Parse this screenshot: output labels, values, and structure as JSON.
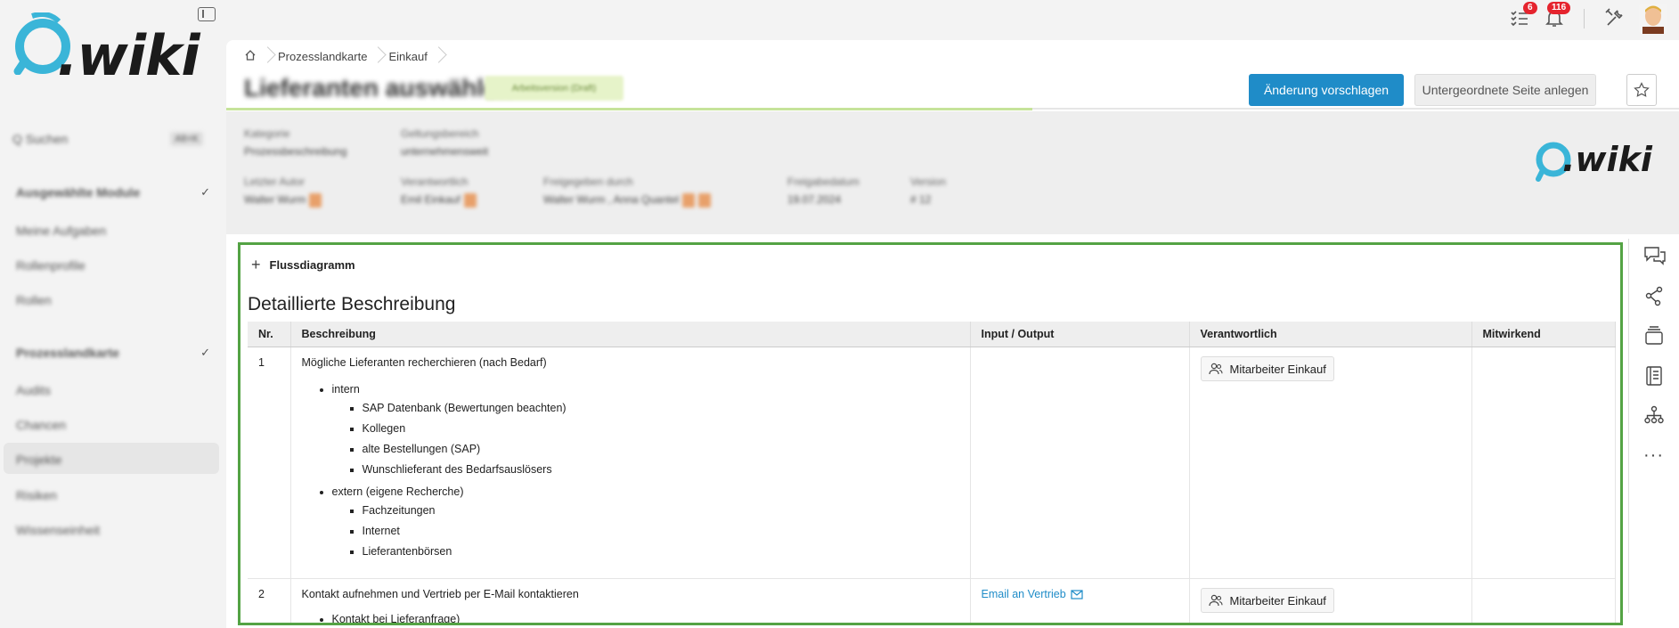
{
  "app": {
    "logo_text": ".wiki"
  },
  "sidebar": {
    "search_label": "Q Suchen",
    "search_shortcut": "Alt+K",
    "items": [
      {
        "label": "Ausgewählte Module",
        "top": 0
      },
      {
        "label": "Meine Aufgaben",
        "top": 0
      },
      {
        "label": "Rollenprofile",
        "top": 0
      },
      {
        "label": "Rollen",
        "top": 0
      },
      {
        "label": "Prozesslandkarte",
        "top": 0
      },
      {
        "label": "Audits",
        "top": 0
      },
      {
        "label": "Chancen",
        "top": 0
      },
      {
        "label": "Projekte",
        "top": 0
      },
      {
        "label": "Risiken",
        "top": 0
      },
      {
        "label": "Wissenseinheit",
        "top": 0
      }
    ]
  },
  "topbar": {
    "tasks_badge": "6",
    "notifications_badge": "116"
  },
  "breadcrumb": {
    "items": [
      "Prozesslandkarte",
      "Einkauf"
    ]
  },
  "page": {
    "title": "Lieferanten auswählen",
    "status": "Arbeitsversion (Draft)",
    "suggest_button": "Änderung vorschlagen",
    "subpage_button": "Untergeordnete Seite anlegen"
  },
  "meta": {
    "category_label": "Kategorie",
    "category_value": "Prozessbeschreibung",
    "scope_label": "Geltungsbereich",
    "scope_value": "unternehmensweit",
    "author_label": "Letzter Autor",
    "author_value": "Walter Wurm",
    "responsible_label": "Verantwortlich",
    "responsible_value": "Emil Einkauf",
    "released_label": "Freigegeben durch",
    "released_value": "Walter Wurm , Anna Quantel",
    "release_date_label": "Freigabedatum",
    "release_date_value": "19.07.2024",
    "version_label": "Version",
    "version_value": "# 12"
  },
  "content": {
    "flow_toggle": "Flussdiagramm",
    "section_title": "Detaillierte Beschreibung",
    "columns": [
      "Nr.",
      "Beschreibung",
      "Input / Output",
      "Verantwortlich",
      "Mitwirkend"
    ],
    "rows": [
      {
        "nr": "1",
        "title": "Mögliche Lieferanten recherchieren (nach Bedarf)",
        "groups": [
          {
            "label": "intern",
            "items": [
              "SAP Datenbank (Bewertungen beachten)",
              "Kollegen",
              "alte Bestellungen (SAP)",
              "Wunschlieferant des Bedarfsauslösers"
            ]
          },
          {
            "label": "extern (eigene Recherche)",
            "items": [
              "Fachzeitungen",
              "Internet",
              "Lieferantenbörsen"
            ]
          }
        ],
        "io": "",
        "responsible": "Mitarbeiter Einkauf",
        "contributing": ""
      },
      {
        "nr": "2",
        "title": "Kontakt aufnehmen und Vertrieb per E-Mail kontaktieren",
        "cutoff_text": "Kontakt bei Lieferanfrage)",
        "io": "Email an Vertrieb",
        "responsible": "Mitarbeiter Einkauf",
        "contributing": ""
      }
    ]
  },
  "colors": {
    "primary": "#1f8cc8",
    "highlight_border": "#54a344",
    "badge": "#e5242e"
  }
}
